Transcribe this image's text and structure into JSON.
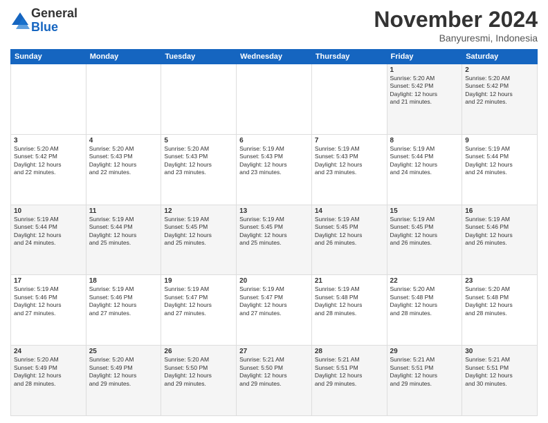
{
  "logo": {
    "general": "General",
    "blue": "Blue"
  },
  "title": "November 2024",
  "location": "Banyuresmi, Indonesia",
  "days_of_week": [
    "Sunday",
    "Monday",
    "Tuesday",
    "Wednesday",
    "Thursday",
    "Friday",
    "Saturday"
  ],
  "weeks": [
    [
      {
        "day": "",
        "info": ""
      },
      {
        "day": "",
        "info": ""
      },
      {
        "day": "",
        "info": ""
      },
      {
        "day": "",
        "info": ""
      },
      {
        "day": "",
        "info": ""
      },
      {
        "day": "1",
        "info": "Sunrise: 5:20 AM\nSunset: 5:42 PM\nDaylight: 12 hours\nand 21 minutes."
      },
      {
        "day": "2",
        "info": "Sunrise: 5:20 AM\nSunset: 5:42 PM\nDaylight: 12 hours\nand 22 minutes."
      }
    ],
    [
      {
        "day": "3",
        "info": "Sunrise: 5:20 AM\nSunset: 5:42 PM\nDaylight: 12 hours\nand 22 minutes."
      },
      {
        "day": "4",
        "info": "Sunrise: 5:20 AM\nSunset: 5:43 PM\nDaylight: 12 hours\nand 22 minutes."
      },
      {
        "day": "5",
        "info": "Sunrise: 5:20 AM\nSunset: 5:43 PM\nDaylight: 12 hours\nand 23 minutes."
      },
      {
        "day": "6",
        "info": "Sunrise: 5:19 AM\nSunset: 5:43 PM\nDaylight: 12 hours\nand 23 minutes."
      },
      {
        "day": "7",
        "info": "Sunrise: 5:19 AM\nSunset: 5:43 PM\nDaylight: 12 hours\nand 23 minutes."
      },
      {
        "day": "8",
        "info": "Sunrise: 5:19 AM\nSunset: 5:44 PM\nDaylight: 12 hours\nand 24 minutes."
      },
      {
        "day": "9",
        "info": "Sunrise: 5:19 AM\nSunset: 5:44 PM\nDaylight: 12 hours\nand 24 minutes."
      }
    ],
    [
      {
        "day": "10",
        "info": "Sunrise: 5:19 AM\nSunset: 5:44 PM\nDaylight: 12 hours\nand 24 minutes."
      },
      {
        "day": "11",
        "info": "Sunrise: 5:19 AM\nSunset: 5:44 PM\nDaylight: 12 hours\nand 25 minutes."
      },
      {
        "day": "12",
        "info": "Sunrise: 5:19 AM\nSunset: 5:45 PM\nDaylight: 12 hours\nand 25 minutes."
      },
      {
        "day": "13",
        "info": "Sunrise: 5:19 AM\nSunset: 5:45 PM\nDaylight: 12 hours\nand 25 minutes."
      },
      {
        "day": "14",
        "info": "Sunrise: 5:19 AM\nSunset: 5:45 PM\nDaylight: 12 hours\nand 26 minutes."
      },
      {
        "day": "15",
        "info": "Sunrise: 5:19 AM\nSunset: 5:45 PM\nDaylight: 12 hours\nand 26 minutes."
      },
      {
        "day": "16",
        "info": "Sunrise: 5:19 AM\nSunset: 5:46 PM\nDaylight: 12 hours\nand 26 minutes."
      }
    ],
    [
      {
        "day": "17",
        "info": "Sunrise: 5:19 AM\nSunset: 5:46 PM\nDaylight: 12 hours\nand 27 minutes."
      },
      {
        "day": "18",
        "info": "Sunrise: 5:19 AM\nSunset: 5:46 PM\nDaylight: 12 hours\nand 27 minutes."
      },
      {
        "day": "19",
        "info": "Sunrise: 5:19 AM\nSunset: 5:47 PM\nDaylight: 12 hours\nand 27 minutes."
      },
      {
        "day": "20",
        "info": "Sunrise: 5:19 AM\nSunset: 5:47 PM\nDaylight: 12 hours\nand 27 minutes."
      },
      {
        "day": "21",
        "info": "Sunrise: 5:19 AM\nSunset: 5:48 PM\nDaylight: 12 hours\nand 28 minutes."
      },
      {
        "day": "22",
        "info": "Sunrise: 5:20 AM\nSunset: 5:48 PM\nDaylight: 12 hours\nand 28 minutes."
      },
      {
        "day": "23",
        "info": "Sunrise: 5:20 AM\nSunset: 5:48 PM\nDaylight: 12 hours\nand 28 minutes."
      }
    ],
    [
      {
        "day": "24",
        "info": "Sunrise: 5:20 AM\nSunset: 5:49 PM\nDaylight: 12 hours\nand 28 minutes."
      },
      {
        "day": "25",
        "info": "Sunrise: 5:20 AM\nSunset: 5:49 PM\nDaylight: 12 hours\nand 29 minutes."
      },
      {
        "day": "26",
        "info": "Sunrise: 5:20 AM\nSunset: 5:50 PM\nDaylight: 12 hours\nand 29 minutes."
      },
      {
        "day": "27",
        "info": "Sunrise: 5:21 AM\nSunset: 5:50 PM\nDaylight: 12 hours\nand 29 minutes."
      },
      {
        "day": "28",
        "info": "Sunrise: 5:21 AM\nSunset: 5:51 PM\nDaylight: 12 hours\nand 29 minutes."
      },
      {
        "day": "29",
        "info": "Sunrise: 5:21 AM\nSunset: 5:51 PM\nDaylight: 12 hours\nand 29 minutes."
      },
      {
        "day": "30",
        "info": "Sunrise: 5:21 AM\nSunset: 5:51 PM\nDaylight: 12 hours\nand 30 minutes."
      }
    ]
  ]
}
